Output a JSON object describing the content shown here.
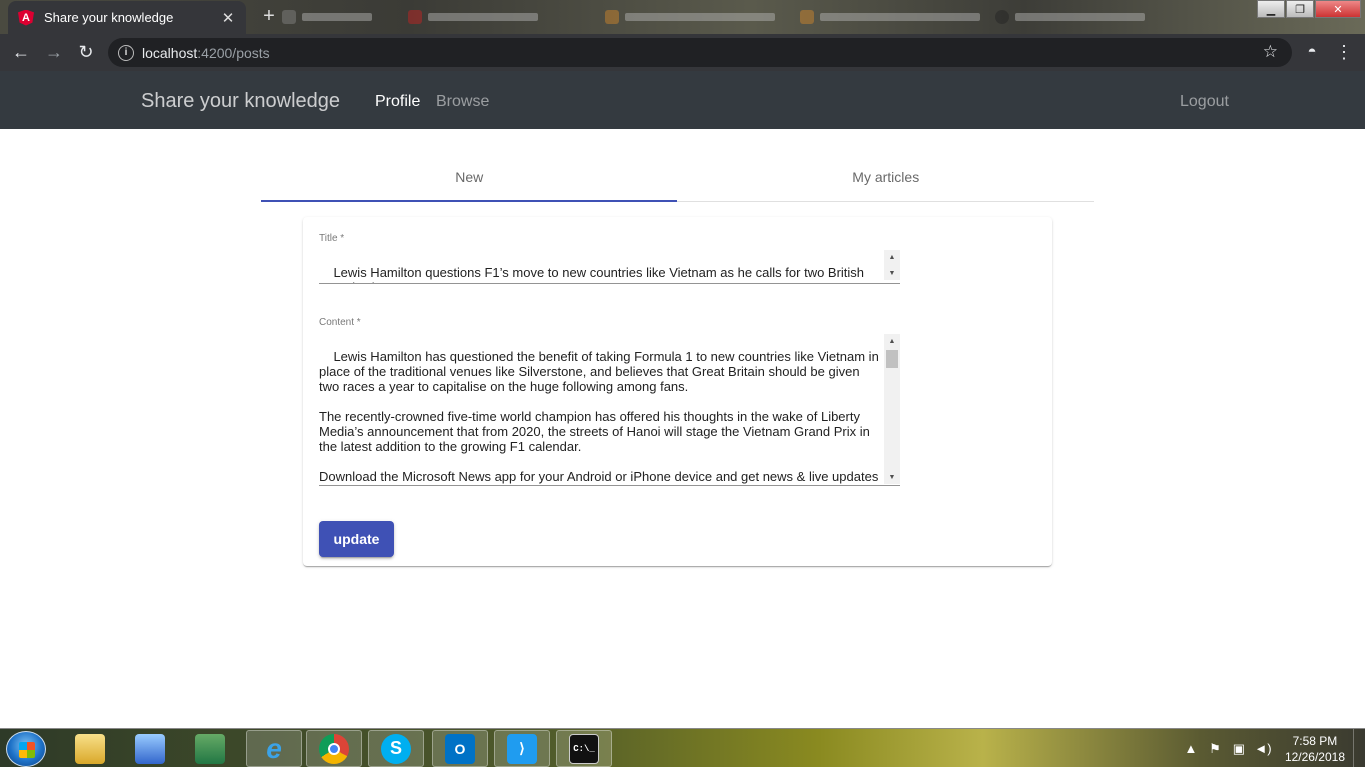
{
  "browser": {
    "active_tab_title": "Share your knowledge",
    "url_host": "localhost",
    "url_path": ":4200/posts"
  },
  "navbar": {
    "brand": "Share your knowledge",
    "links": [
      "Profile",
      "Browse"
    ],
    "active_link": "Profile",
    "logout": "Logout"
  },
  "tabs": {
    "items": [
      "New",
      "My articles"
    ],
    "selected": "New"
  },
  "form": {
    "title_label": "Title *",
    "title_value": "Lewis Hamilton questions F1’s move to new countries like Vietnam as he calls for two British Grand Prixs",
    "content_label": "Content *",
    "content_value": "Lewis Hamilton has questioned the benefit of taking Formula 1 to new countries like Vietnam in place of the traditional venues like Silverstone, and believes that Great Britain should be given two races a year to capitalise on the huge following among fans.\n\nThe recently-crowned five-time world champion has offered his thoughts in the wake of Liberty Media’s announcement that from 2020, the streets of Hanoi will stage the Vietnam Grand Prix in the latest addition to the growing F1 calendar.\n\nDownload the Microsoft News app for your Android or iPhone device and get news & live updates on the go.",
    "submit_label": "update"
  },
  "taskbar": {
    "time": "7:58 PM",
    "date": "12/26/2018"
  },
  "colors": {
    "navbar_bg": "#343a40",
    "primary": "#3f51b5",
    "browser_toolbar": "#35363a"
  }
}
